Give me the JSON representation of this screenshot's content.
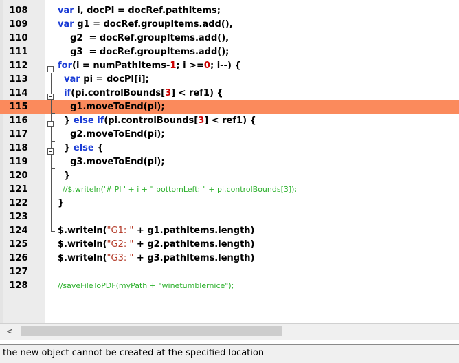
{
  "editor": {
    "highlight_color": "#fb8a5c",
    "colors": {
      "keyword": "#1a3cd6",
      "comment": "#2cb02c",
      "string": "#b43c2a",
      "number": "#cc0000"
    },
    "lines": [
      {
        "num": "108",
        "tokens": [
          {
            "t": "kw",
            "v": "var"
          },
          {
            "t": "p",
            "v": " i, docPI = docRef.pathItems;"
          }
        ]
      },
      {
        "num": "109",
        "tokens": [
          {
            "t": "kw",
            "v": "var"
          },
          {
            "t": "p",
            "v": " g1 = docRef.groupItems.add"
          },
          {
            "t": "op",
            "v": "(),"
          }
        ]
      },
      {
        "num": "110",
        "tokens": [
          {
            "t": "p",
            "v": "    g2  = docRef.groupItems.add"
          },
          {
            "t": "op",
            "v": "(),"
          }
        ]
      },
      {
        "num": "111",
        "tokens": [
          {
            "t": "p",
            "v": "    g3  = docRef.groupItems.add"
          },
          {
            "t": "op",
            "v": "();"
          }
        ]
      },
      {
        "num": "112",
        "tokens": [
          {
            "t": "kw",
            "v": "for"
          },
          {
            "t": "p",
            "v": "(i = numPathItems-"
          },
          {
            "t": "num",
            "v": "1"
          },
          {
            "t": "p",
            "v": "; i >="
          },
          {
            "t": "num",
            "v": "0"
          },
          {
            "t": "p",
            "v": "; i--) {"
          }
        ]
      },
      {
        "num": "113",
        "tokens": [
          {
            "t": "p",
            "v": "  "
          },
          {
            "t": "kw",
            "v": "var"
          },
          {
            "t": "p",
            "v": " pi = docPI[i];"
          }
        ]
      },
      {
        "num": "114",
        "tokens": [
          {
            "t": "p",
            "v": "  "
          },
          {
            "t": "kw",
            "v": "if"
          },
          {
            "t": "p",
            "v": "(pi.controlBounds["
          },
          {
            "t": "num",
            "v": "3"
          },
          {
            "t": "p",
            "v": "] < ref1) {"
          }
        ]
      },
      {
        "num": "115",
        "tokens": [
          {
            "t": "p",
            "v": "    g1.moveToEnd(pi);"
          }
        ],
        "highlight": true
      },
      {
        "num": "116",
        "tokens": [
          {
            "t": "p",
            "v": "  } "
          },
          {
            "t": "kw",
            "v": "else if"
          },
          {
            "t": "p",
            "v": "(pi.controlBounds["
          },
          {
            "t": "num",
            "v": "3"
          },
          {
            "t": "p",
            "v": "] < ref1) {"
          }
        ]
      },
      {
        "num": "117",
        "tokens": [
          {
            "t": "p",
            "v": "    g2.moveToEnd(pi);"
          }
        ]
      },
      {
        "num": "118",
        "tokens": [
          {
            "t": "p",
            "v": "  } "
          },
          {
            "t": "kw",
            "v": "else"
          },
          {
            "t": "p",
            "v": " {"
          }
        ]
      },
      {
        "num": "119",
        "tokens": [
          {
            "t": "p",
            "v": "    g3.moveToEnd(pi);"
          }
        ]
      },
      {
        "num": "120",
        "tokens": [
          {
            "t": "p",
            "v": "  }"
          }
        ]
      },
      {
        "num": "121",
        "comment": "  //$.writeln('# PI ' + i + \" bottomLeft: \" + pi.controlBounds[3]);"
      },
      {
        "num": "122",
        "tokens": [
          {
            "t": "p",
            "v": "}"
          }
        ]
      },
      {
        "num": "123",
        "tokens": []
      },
      {
        "num": "124",
        "tokens": [
          {
            "t": "p",
            "v": "$.writeln("
          },
          {
            "t": "str",
            "v": "\"G1: \""
          },
          {
            "t": "p",
            "v": " + g1.pathItems.length)"
          }
        ]
      },
      {
        "num": "125",
        "tokens": [
          {
            "t": "p",
            "v": "$.writeln("
          },
          {
            "t": "str",
            "v": "\"G2: \""
          },
          {
            "t": "p",
            "v": " + g2.pathItems.length)"
          }
        ]
      },
      {
        "num": "126",
        "tokens": [
          {
            "t": "p",
            "v": "$.writeln("
          },
          {
            "t": "str",
            "v": "\"G3: \""
          },
          {
            "t": "p",
            "v": " + g3.pathItems.length)"
          }
        ]
      },
      {
        "num": "127",
        "tokens": []
      },
      {
        "num": "128",
        "comment": "//saveFileToPDF(myPath + \"winetumblernice\");"
      }
    ]
  },
  "scrollbar": {
    "left_arrow": "<"
  },
  "status": {
    "message": "the new object cannot be created at the specified location"
  }
}
